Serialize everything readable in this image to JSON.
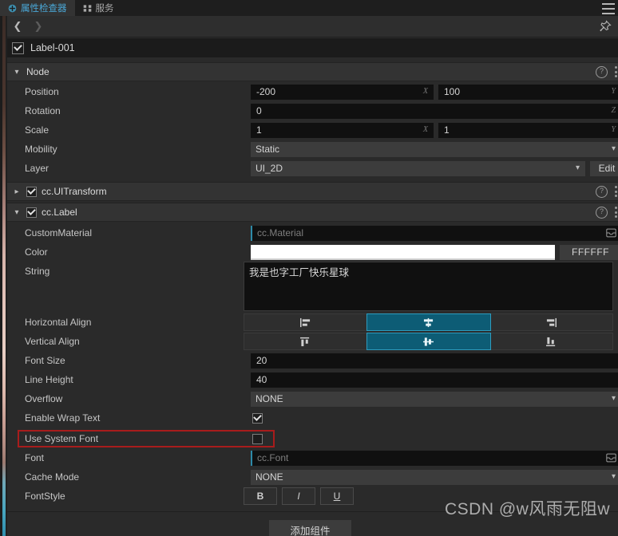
{
  "window": {
    "tabs": [
      {
        "label": "属性检查器",
        "icon": "inspector-icon",
        "active": true
      },
      {
        "label": "服务",
        "icon": "services-grid-icon",
        "active": false
      }
    ],
    "menu_icon": "hamburger-menu-icon",
    "pin_icon": "pin-icon",
    "nav_back_icon": "chevron-left-icon",
    "nav_forward_icon": "chevron-right-icon"
  },
  "node_header": {
    "name": "Label-001",
    "enabled": true
  },
  "sections": {
    "node": {
      "title": "Node",
      "expanded": true,
      "help_icon": "help-circle-icon",
      "menu_icon": "kebab-menu-icon"
    },
    "uitransform": {
      "title": "cc.UITransform",
      "expanded": false,
      "enabled": true,
      "help_icon": "help-circle-icon",
      "menu_icon": "kebab-menu-icon"
    },
    "label": {
      "title": "cc.Label",
      "expanded": true,
      "enabled": true,
      "help_icon": "help-circle-icon",
      "menu_icon": "kebab-menu-icon"
    }
  },
  "node_props": {
    "position": {
      "label": "Position",
      "x": "-200",
      "y": "100",
      "axis_x": "X",
      "axis_y": "Y"
    },
    "rotation": {
      "label": "Rotation",
      "z": "0",
      "axis_z": "Z"
    },
    "scale": {
      "label": "Scale",
      "x": "1",
      "y": "1",
      "axis_x": "X",
      "axis_y": "Y"
    },
    "mobility": {
      "label": "Mobility",
      "value": "Static"
    },
    "layer": {
      "label": "Layer",
      "value": "UI_2D",
      "edit_label": "Edit"
    }
  },
  "label_props": {
    "custom_material": {
      "label": "CustomMaterial",
      "placeholder": "cc.Material",
      "picker_icon": "asset-box-icon"
    },
    "color": {
      "label": "Color",
      "swatch_hex": "#FFFFFF",
      "hex": "FFFFFF"
    },
    "string": {
      "label": "String",
      "value": "我是也字工厂快乐星球"
    },
    "horizontal_align": {
      "label": "Horizontal Align",
      "options": [
        "align-left-icon",
        "align-center-icon",
        "align-right-icon"
      ],
      "selected": 1
    },
    "vertical_align": {
      "label": "Vertical Align",
      "options": [
        "align-top-icon",
        "align-middle-icon",
        "align-bottom-icon"
      ],
      "selected": 1
    },
    "font_size": {
      "label": "Font Size",
      "value": "20"
    },
    "line_height": {
      "label": "Line Height",
      "value": "40"
    },
    "overflow": {
      "label": "Overflow",
      "value": "NONE"
    },
    "enable_wrap_text": {
      "label": "Enable Wrap Text",
      "checked": true
    },
    "use_system_font": {
      "label": "Use System Font",
      "checked": false,
      "highlighted": true
    },
    "font": {
      "label": "Font",
      "placeholder": "cc.Font",
      "picker_icon": "asset-box-icon"
    },
    "cache_mode": {
      "label": "Cache Mode",
      "value": "NONE"
    },
    "font_style": {
      "label": "FontStyle",
      "bold": "B",
      "italic": "I",
      "underline": "U"
    }
  },
  "footer": {
    "add_component": "添加组件",
    "watermark": "CSDN @w风雨无阻w"
  },
  "colors": {
    "accent": "#4aa8d8",
    "selected_fill": "#0d5c75",
    "selected_border": "#2d9bbd",
    "annotation": "#a81c1c",
    "panel_bg": "#2a2a2a",
    "header_bg": "#333333",
    "input_bg": "#101010"
  }
}
